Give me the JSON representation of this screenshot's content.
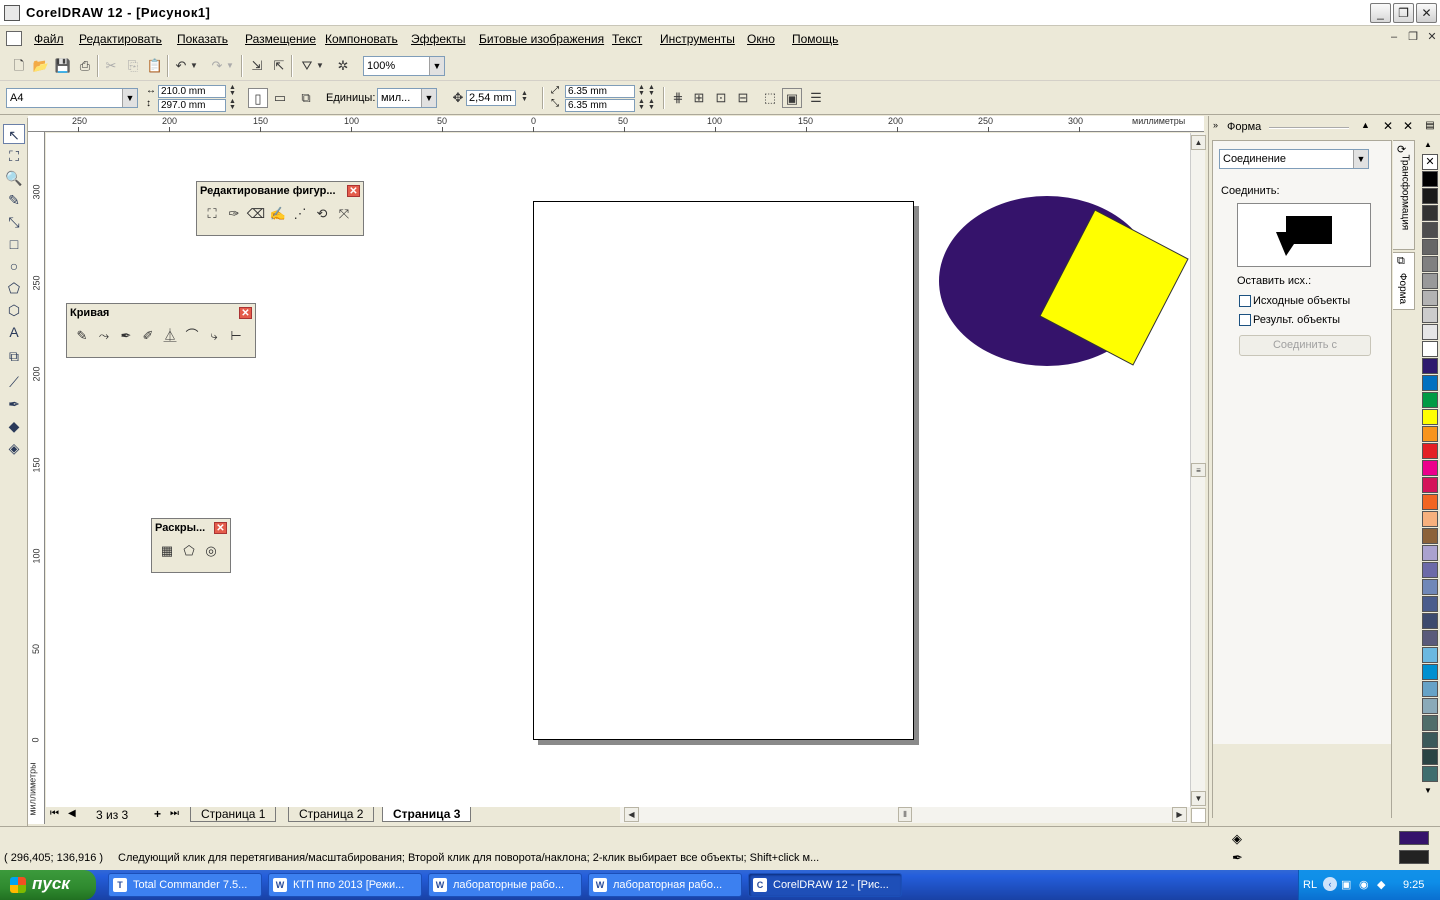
{
  "window": {
    "title": "CorelDRAW 12 - [Рисунок1]"
  },
  "menu": [
    "Файл",
    "Редактировать",
    "Показать",
    "Размещение",
    "Компоновать",
    "Эффекты",
    "Битовые изображения",
    "Текст",
    "Инструменты",
    "Окно",
    "Помощь"
  ],
  "toolbar": {
    "zoom": "100%"
  },
  "propbar": {
    "paper": "A4",
    "width": "210.0 mm",
    "height": "297.0 mm",
    "units_label": "Единицы:",
    "units_value": "мил...",
    "nudge": "2,54 mm",
    "dup_x": "6.35 mm",
    "dup_y": "6.35 mm"
  },
  "hruler": {
    "labels": [
      "250",
      "200",
      "150",
      "100",
      "50",
      "0",
      "50",
      "100",
      "150",
      "200",
      "250",
      "300"
    ],
    "unit": "миллиметры"
  },
  "vruler": {
    "labels": [
      "300",
      "250",
      "200",
      "150",
      "100",
      "50",
      "0"
    ],
    "unit": "миллиметры"
  },
  "floating": {
    "shape_edit": "Редактирование фигур...",
    "curve": "Кривая",
    "shading": "Раскры..."
  },
  "pagenav": {
    "count": "3 из 3",
    "tabs": [
      "Страница 1",
      "Страница 2",
      "Страница 3"
    ],
    "active": "Страница 3"
  },
  "docker": {
    "title": "Форма",
    "mode": "Соединение",
    "connect_label": "Соединить:",
    "keep_label": "Оставить исх.:",
    "chk_source": "Исходные объекты",
    "chk_result": "Результ. объекты",
    "button": "Соединить с",
    "tab_transform": "Трансформация",
    "tab_shape": "Форма"
  },
  "colors": {
    "ellipse": "#35136b",
    "square": "#ffff00"
  },
  "status": {
    "coords": "( 296,405; 136,916 )",
    "message": "Следующий клик для перетягивания/масштабирования; Второй клик для поворота/наклона; 2-клик выбирает все объекты; Shift+click м..."
  },
  "taskbar": {
    "start": "пуск",
    "items": [
      "Total Commander 7.5...",
      "КТП ппо 2013 [Режи...",
      "лабораторные рабо...",
      "лабораторная рабо...",
      "CorelDRAW 12 - [Рис..."
    ],
    "lang": "RL",
    "time": "9:25"
  }
}
